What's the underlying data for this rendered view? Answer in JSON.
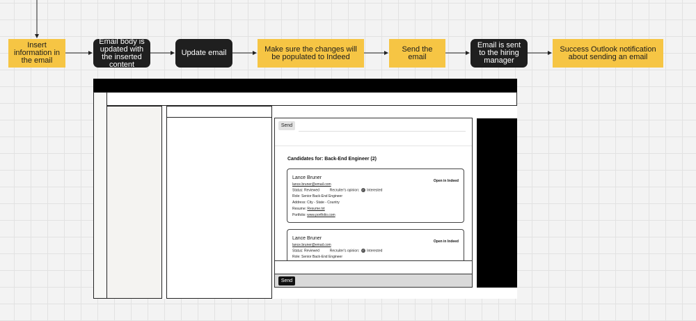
{
  "flow": {
    "steps": [
      {
        "label": "Insert information in the email",
        "style": "yellow"
      },
      {
        "label": "Email body is updated with the inserted content",
        "style": "dark"
      },
      {
        "label": "Update email",
        "style": "dark"
      },
      {
        "label": "Make sure the changes will be populated to Indeed",
        "style": "yellow"
      },
      {
        "label": "Send the email",
        "style": "yellow"
      },
      {
        "label": "Email is sent to the hiring manager",
        "style": "dark"
      },
      {
        "label": "Success Outlook notification about sending an email",
        "style": "yellow"
      }
    ],
    "colors": {
      "yellow": "#f6c544",
      "dark": "#1f1f1f"
    }
  },
  "email_client": {
    "compose": {
      "send_top_label": "Send",
      "send_bottom_label": "Send",
      "candidates_title": "Candidates for: Back-End Engineer (2)",
      "candidates": [
        {
          "name": "Lance Bruner",
          "email": "lance.bruner@email.com",
          "open_link": "Open in Indeed",
          "status_label": "Status: Reviewed",
          "opinion_label": "Recruiter's opinion:",
          "opinion_value": "Interested",
          "role": "Role: Senior Back-End Engineer",
          "address": "Address: City - State - Country",
          "resume_label": "Resume:",
          "resume_file": "Resume.txt",
          "portfolio_label": "Portfolio:",
          "portfolio_url": "www.portfolio.com"
        },
        {
          "name": "Lance Bruner",
          "email": "lance.bruner@email.com",
          "open_link": "Open in Indeed",
          "status_label": "Status: Reviewed",
          "opinion_label": "Recruiter's opinion:",
          "opinion_value": "Interested",
          "role": "Role: Senior Back-End Engineer"
        }
      ]
    }
  }
}
